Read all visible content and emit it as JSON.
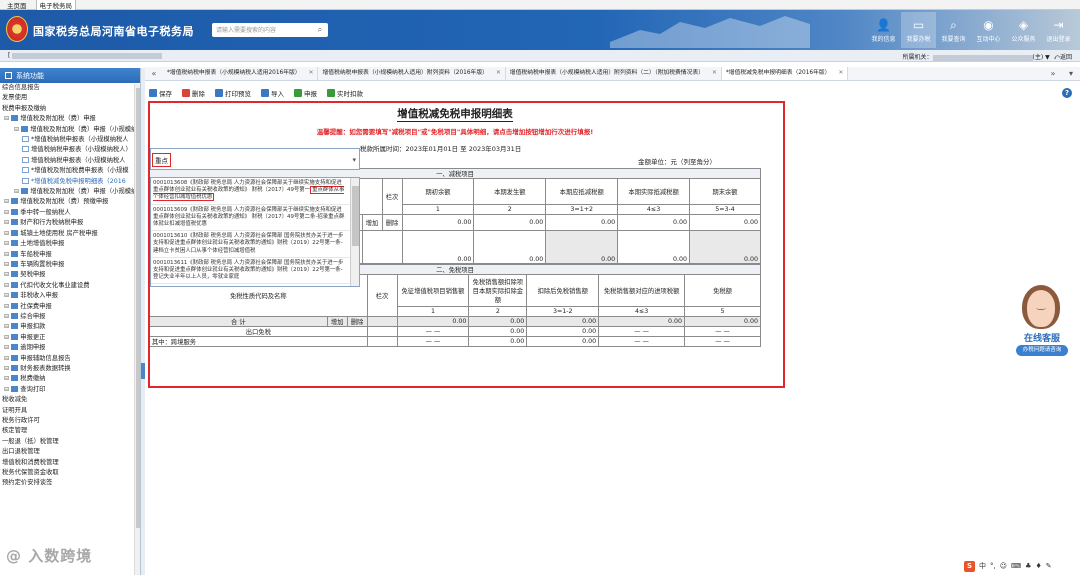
{
  "browser_tabs": [
    "主页面",
    "电子税务局"
  ],
  "header": {
    "brand": "国家税务总局河南省电子税务局",
    "search_placeholder": "请输入需要搜索的内容",
    "nav": [
      {
        "label": "我的信息",
        "icon": "user-icon"
      },
      {
        "label": "我要办税",
        "icon": "monitor-icon"
      },
      {
        "label": "我要查询",
        "icon": "search-doc-icon"
      },
      {
        "label": "互动中心",
        "icon": "chat-icon"
      },
      {
        "label": "公众服务",
        "icon": "service-icon"
      },
      {
        "label": "退出登录",
        "icon": "logout-icon"
      }
    ]
  },
  "userbar": {
    "left_prefix": "[",
    "right_prefix": "所属机关：",
    "right_suffix": "(主) ▼",
    "back": "返回"
  },
  "sidebar": {
    "title": "系统功能",
    "items": [
      {
        "label": "综合信息报告",
        "level": 0
      },
      {
        "label": "发票使用",
        "level": 0
      },
      {
        "label": "税费申报及缴纳",
        "level": 0
      },
      {
        "label": "增值税及附加税（费）申报",
        "level": 1,
        "icon": "folder"
      },
      {
        "label": "增值税及附加税（费）申报（小规模纳",
        "level": 2,
        "icon": "folder"
      },
      {
        "label": "*增值税纳税申报表（小规模纳税人",
        "level": 3,
        "icon": "doc"
      },
      {
        "label": "增值税纳税申报表（小规模纳税人）",
        "level": 3,
        "icon": "doc"
      },
      {
        "label": "增值税纳税申报表（小规模纳税人",
        "level": 3,
        "icon": "doc"
      },
      {
        "label": "*增值税及附加税费申报表（小规模",
        "level": 3,
        "icon": "doc"
      },
      {
        "label": "*增值税减免税申报明细表（2016",
        "level": 3,
        "icon": "doc",
        "current": true
      },
      {
        "label": "增值税及附加税（费）申报（小规模纳",
        "level": 2,
        "icon": "folder"
      },
      {
        "label": "增值税及附加税（费）预缴申报",
        "level": 1,
        "icon": "folder"
      },
      {
        "label": "季中转一般纳税人",
        "level": 1,
        "icon": "folder"
      },
      {
        "label": "财产和行为税纳税申报",
        "level": 1,
        "icon": "folder"
      },
      {
        "label": "城镇土地使用税 房产税申报",
        "level": 1,
        "icon": "folder"
      },
      {
        "label": "土地增值税申报",
        "level": 1,
        "icon": "folder"
      },
      {
        "label": "车船税申报",
        "level": 1,
        "icon": "folder"
      },
      {
        "label": "车辆购置税申报",
        "level": 1,
        "icon": "folder"
      },
      {
        "label": "契税申报",
        "level": 1,
        "icon": "folder"
      },
      {
        "label": "代扣代收文化事业建设费",
        "level": 1,
        "icon": "folder"
      },
      {
        "label": "非税收入申报",
        "level": 1,
        "icon": "folder"
      },
      {
        "label": "社保费申报",
        "level": 1,
        "icon": "folder"
      },
      {
        "label": "综合申报",
        "level": 1,
        "icon": "folder"
      },
      {
        "label": "申报扣款",
        "level": 1,
        "icon": "folder"
      },
      {
        "label": "申报更正",
        "level": 1,
        "icon": "folder"
      },
      {
        "label": "逾期申报",
        "level": 1,
        "icon": "folder"
      },
      {
        "label": "申报辅助信息报告",
        "level": 1,
        "icon": "folder"
      },
      {
        "label": "财务报表数据转换",
        "level": 1,
        "icon": "folder"
      },
      {
        "label": "税费缴纳",
        "level": 1,
        "icon": "folder"
      },
      {
        "label": "查询打印",
        "level": 1,
        "icon": "folder"
      },
      {
        "label": "税收减免",
        "level": 0
      },
      {
        "label": "证明开具",
        "level": 0
      },
      {
        "label": "税务行政许可",
        "level": 0
      },
      {
        "label": "核定管理",
        "level": 0
      },
      {
        "label": "一般退（抵）税管理",
        "level": 0
      },
      {
        "label": "出口退税管理",
        "level": 0
      },
      {
        "label": "增值税和消费税管理",
        "level": 0
      },
      {
        "label": "税务代保管资金收取",
        "level": 0
      },
      {
        "label": "预约定价安排谈签",
        "level": 0
      }
    ]
  },
  "tabs": [
    {
      "label": "*增值税纳税申报表（小规模纳税人适用2016年版）"
    },
    {
      "label": "增值税纳税申报表（小规模纳税人适用）附列资料（2016年版）"
    },
    {
      "label": "增值税纳税申报表（小规模纳税人适用）附列资料（二）（附加税费情况表）"
    },
    {
      "label": "*增值税减免税申报明细表（2016年版）",
      "active": true
    }
  ],
  "toolbar": [
    {
      "label": "保存",
      "color": "#3a78c2"
    },
    {
      "label": "删除",
      "color": "#d9443a"
    },
    {
      "label": "打印预览",
      "color": "#3a78c2"
    },
    {
      "label": "导入",
      "color": "#3a78c2"
    },
    {
      "label": "申报",
      "color": "#3a9b3a"
    },
    {
      "label": "实时扣款",
      "color": "#3a9b3a"
    }
  ],
  "form": {
    "title": "增值税减免税申报明细表",
    "warning": "温馨提醒：如您需要填写\"减税项目\"或\"免税项目\"具体明细，请点击增加按钮增加行次进行填报!",
    "period": "税款所属时间：2023年01月01日 至 2023年03月31日",
    "unit": "金额单位：元（列至角分）",
    "section1": "一、减税项目",
    "t1_headers": [
      "栏次",
      "期初余额",
      "本期发生额",
      "本期应抵减税额",
      "本期实际抵减税额",
      "期末余额"
    ],
    "t1_index": [
      "1",
      "2",
      "3=1+2",
      "4≤3",
      "5=3-4"
    ],
    "add_btn": "增加",
    "del_btn": "删除",
    "t1_rows": [
      [
        "0.00",
        "0.00",
        "0.00",
        "0.00",
        "0.00"
      ],
      [
        "0.00",
        "0.00",
        "0.00",
        "0.00",
        "0.00"
      ]
    ],
    "section2": "二、免税项目",
    "t2_col0": "免税性质代码及名称",
    "t2_headers": [
      "栏次",
      "免征增值税项目销售额",
      "免税销售额扣除项目本期实际扣除金额",
      "扣除后免税销售额",
      "免税销售额对应的进项税额",
      "免税额"
    ],
    "t2_index": [
      "1",
      "2",
      "3=1-2",
      "4≤3",
      "5"
    ],
    "total_label": "合    计",
    "total_row": [
      "0.00",
      "0.00",
      "0.00",
      "0.00",
      "0.00"
    ],
    "export_label": "出口免税",
    "export_row": [
      "— —",
      "0.00",
      "0.00",
      "— —",
      "— —"
    ],
    "cross_label": "其中：跨境服务",
    "cross_row": [
      "— —",
      "0.00",
      "0.00",
      "— —",
      "— —"
    ]
  },
  "dropdown": {
    "value": "重点",
    "options": [
      {
        "pre": "0001013608《财政部 税务总局 人力资源社会保障部关于继续实施支持和促进重点群体创业就业有关税收政策的通知》 财税〔2017〕49号第一",
        "hl": "重点群体从事个体经营扣减增值税优惠",
        "post": ""
      },
      {
        "pre": "0001013609《财政部 税务总局 人力资源社会保障部关于继续实施支持和促进重点群体创业就业有关税收政策的通知》 财税〔2017〕49号第二条-招录重点群体就业扣减增值税优惠",
        "hl": "",
        "post": ""
      },
      {
        "pre": "0001013610《财政部 税务总局 人力资源社会保障部 国务院扶贫办关于进一步支持和促进重点群体创业就业有关税收政策的通知》财税〔2019〕22号第一条-建档立卡贫困人口从事个体经营扣减增值税",
        "hl": "",
        "post": ""
      },
      {
        "pre": "0001013611《财政部 税务总局 人力资源社会保障部 国务院扶贫办关于进一步支持和促进重点群体创业就业有关税收政策的通知》财税〔2019〕22号第一条-登记失业半年以上人员，零就业家庭",
        "hl": "",
        "post": ""
      }
    ]
  },
  "cs": {
    "label": "在线客服",
    "sub": "办税问题请咨询"
  },
  "watermark": "@ 入数跨境",
  "ime": [
    "中",
    "°,",
    "☺",
    "⌨",
    "♣",
    "♦",
    "✎"
  ]
}
